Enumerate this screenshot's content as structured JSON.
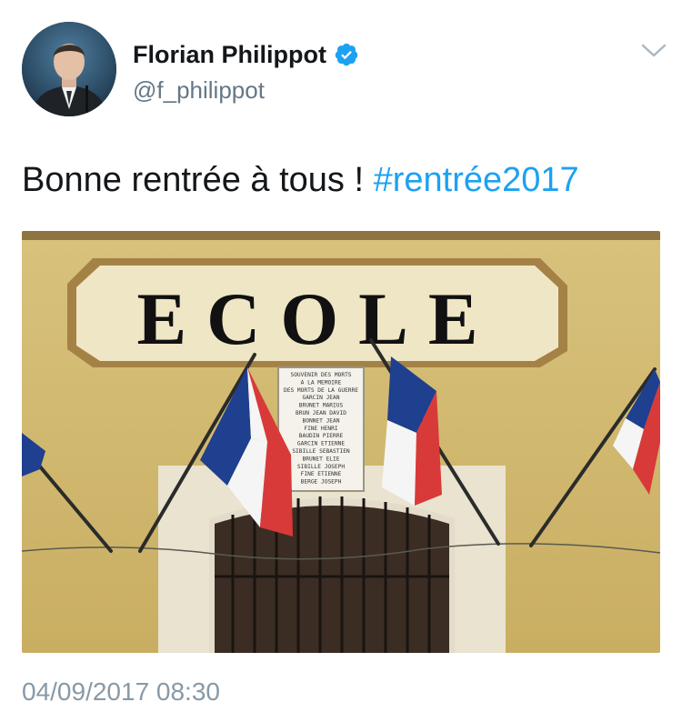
{
  "author": {
    "display_name": "Florian Philippot",
    "handle": "@f_philippot",
    "verified": true,
    "avatar_icon": "profile-photo"
  },
  "tweet": {
    "text": "Bonne rentrée à tous ! ",
    "hashtag": "#rentrée2017",
    "timestamp": "04/09/2017 08:30"
  },
  "photo": {
    "sign_text": "ECOLE",
    "plaque_lines": [
      "SOUVENIR DES MORTS",
      "A LA MEMOIRE",
      "DES MORTS DE LA GUERRE",
      "GARCIN JEAN",
      "BRUNET MARIUS",
      "BRUN JEAN DAVID",
      "BONNET JEAN",
      "FINE HENRI",
      "BAUDIN PIERRE",
      "GARCIN ETIENNE",
      "SIBILLE SEBASTIEN",
      "BRUNET ELIE",
      "SIBILLE JOSEPH",
      "FINE ETIENNE",
      "BERGE JOSEPH"
    ]
  },
  "colors": {
    "link": "#1da1f2",
    "text": "#14171a",
    "secondary": "#657786",
    "timestamp": "#8899a6",
    "flag_blue": "#1f3f8f",
    "flag_red": "#d83a3a"
  },
  "icons": {
    "verified": "verified-badge-icon",
    "menu": "chevron-down-icon"
  }
}
